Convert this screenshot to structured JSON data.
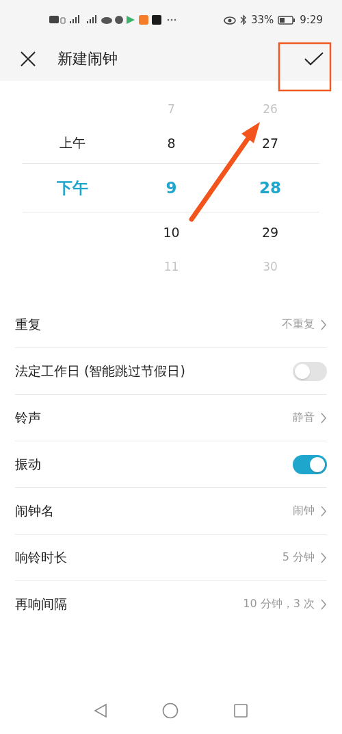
{
  "status_bar": {
    "battery": "33%",
    "time": "9:29"
  },
  "header": {
    "title": "新建闹钟"
  },
  "picker": {
    "rows": [
      {
        "kind": "edge",
        "hour": "7",
        "minute": "26"
      },
      {
        "kind": "near",
        "period": "上午",
        "hour": "8",
        "minute": "27"
      },
      {
        "kind": "selected",
        "period": "下午",
        "hour": "9",
        "minute": "28"
      },
      {
        "kind": "near",
        "hour": "10",
        "minute": "29"
      },
      {
        "kind": "edge",
        "hour": "11",
        "minute": "30"
      }
    ]
  },
  "settings": [
    {
      "kind": "value",
      "label": "重复",
      "value": "不重复"
    },
    {
      "kind": "switch",
      "label": "法定工作日 (智能跳过节假日)",
      "on": false
    },
    {
      "kind": "value",
      "label": "铃声",
      "value": "静音"
    },
    {
      "kind": "switch",
      "label": "振动",
      "on": true
    },
    {
      "kind": "value",
      "label": "闹钟名",
      "value": "闹钟"
    },
    {
      "kind": "value",
      "label": "响铃时长",
      "value": "5 分钟"
    },
    {
      "kind": "value",
      "label": "再响间隔",
      "value": "10 分钟，3 次"
    }
  ],
  "annotation": {
    "box": true,
    "arrow": true
  }
}
